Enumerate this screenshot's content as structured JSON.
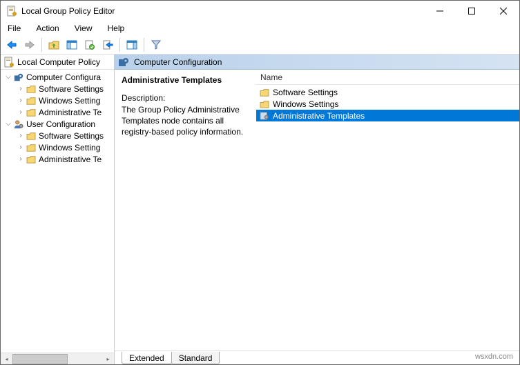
{
  "window": {
    "title": "Local Group Policy Editor"
  },
  "menu": {
    "file": "File",
    "action": "Action",
    "view": "View",
    "help": "Help"
  },
  "tree": {
    "header": "Local Computer Policy",
    "items": [
      {
        "label": "Computer Configura",
        "level": 0,
        "expanded": true,
        "icon": "gear"
      },
      {
        "label": "Software Settings",
        "level": 1,
        "expanded": false,
        "icon": "folder"
      },
      {
        "label": "Windows Setting",
        "level": 1,
        "expanded": false,
        "icon": "folder"
      },
      {
        "label": "Administrative Te",
        "level": 1,
        "expanded": false,
        "icon": "folder"
      },
      {
        "label": "User Configuration",
        "level": 0,
        "expanded": true,
        "icon": "user"
      },
      {
        "label": "Software Settings",
        "level": 1,
        "expanded": false,
        "icon": "folder"
      },
      {
        "label": "Windows Setting",
        "level": 1,
        "expanded": false,
        "icon": "folder"
      },
      {
        "label": "Administrative Te",
        "level": 1,
        "expanded": false,
        "icon": "folder"
      }
    ]
  },
  "content": {
    "header": "Computer Configuration",
    "title": "Administrative Templates",
    "desc_label": "Description:",
    "description": "The Group Policy Administrative Templates node contains all registry-based policy information."
  },
  "list": {
    "column": "Name",
    "items": [
      {
        "label": "Software Settings",
        "icon": "folder",
        "selected": false
      },
      {
        "label": "Windows Settings",
        "icon": "folder",
        "selected": false
      },
      {
        "label": "Administrative Templates",
        "icon": "gear-sheet",
        "selected": true
      }
    ]
  },
  "tabs": {
    "extended": "Extended",
    "standard": "Standard"
  },
  "watermark": "wsxdn.com"
}
